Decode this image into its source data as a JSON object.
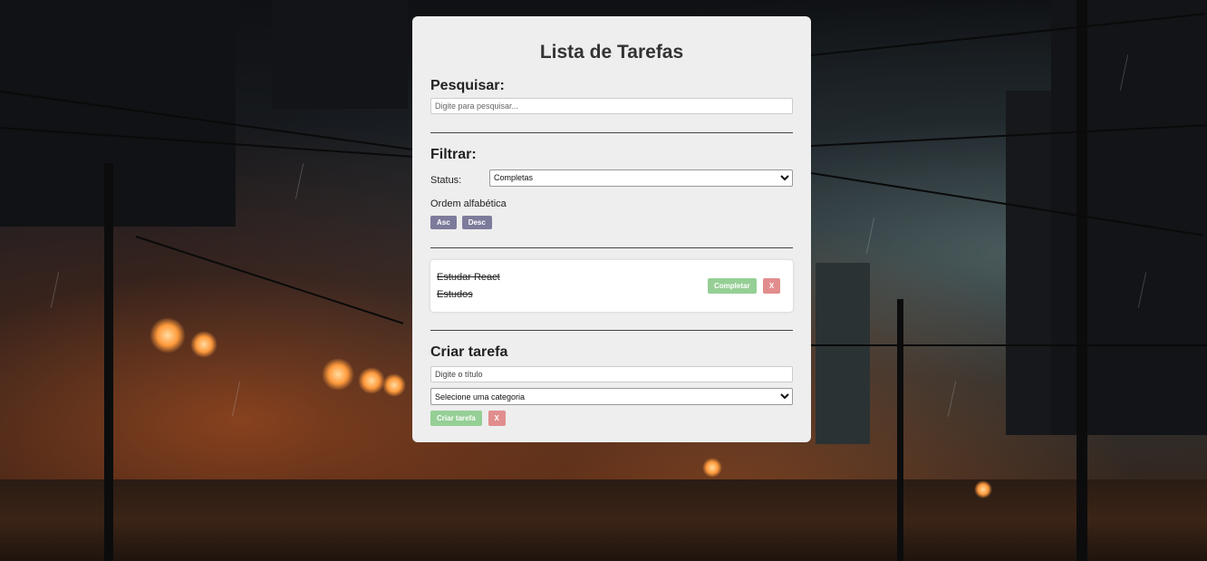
{
  "app": {
    "title": "Lista de Tarefas"
  },
  "search": {
    "heading": "Pesquisar:",
    "placeholder": "Digite para pesquisar...",
    "value": ""
  },
  "filter": {
    "heading": "Filtrar:",
    "status_label": "Status:",
    "status_selected": "Completas",
    "order_label": "Ordem alfabética",
    "asc_label": "Asc",
    "desc_label": "Desc"
  },
  "tasks": [
    {
      "title": "Estudar React",
      "category": "Estudos",
      "completed": true,
      "complete_label": "Completar",
      "delete_label": "X"
    }
  ],
  "create": {
    "heading": "Criar tarefa",
    "title_placeholder": "Digite o título",
    "category_selected": "Selecione uma categoria",
    "submit_label": "Criar tarefa",
    "cancel_label": "X"
  },
  "colors": {
    "card_bg": "#eeeeee",
    "sort_button": "#7d7b9b",
    "complete_button": "#95cf95",
    "delete_button": "#e28d8d"
  }
}
